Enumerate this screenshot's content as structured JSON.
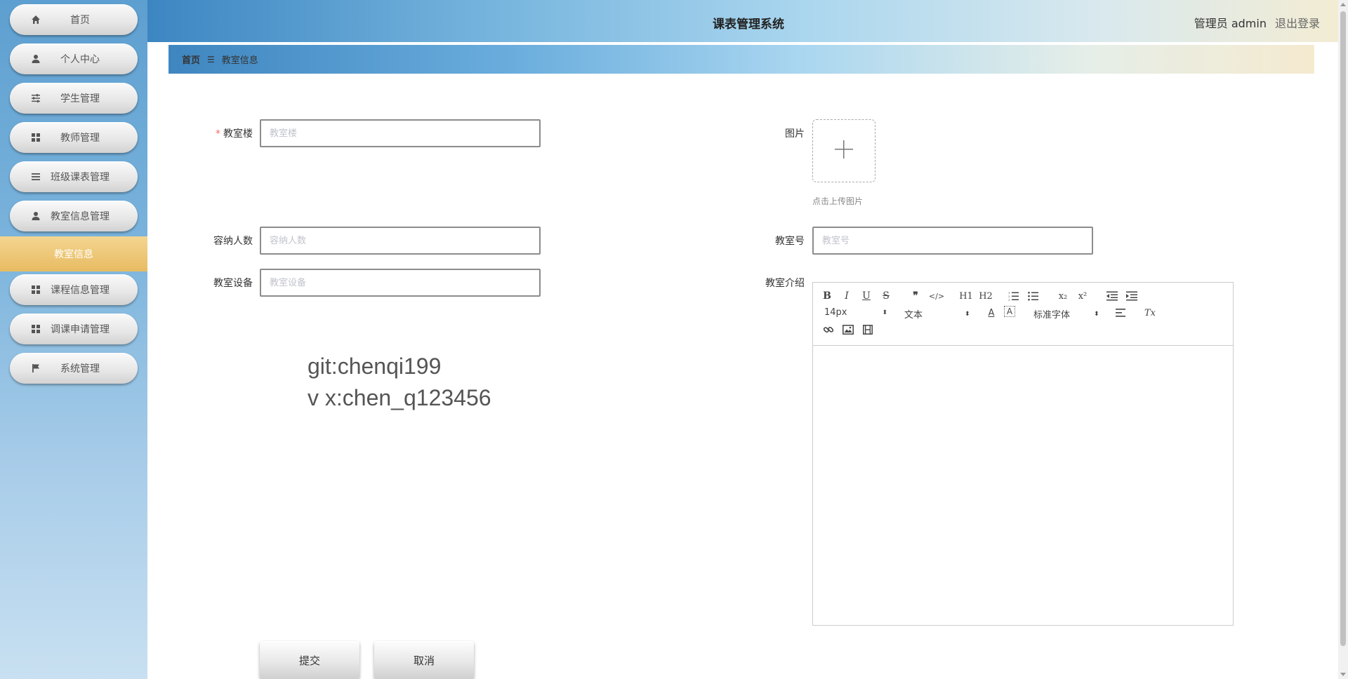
{
  "app": {
    "title": "课表管理系统"
  },
  "header": {
    "user_label": "管理员 admin",
    "logout_label": "退出登录"
  },
  "sidebar": {
    "items": [
      {
        "label": "首页",
        "icon": "home-icon"
      },
      {
        "label": "个人中心",
        "icon": "user-icon"
      },
      {
        "label": "学生管理",
        "icon": "sliders-icon"
      },
      {
        "label": "教师管理",
        "icon": "grid-icon"
      },
      {
        "label": "班级课表管理",
        "icon": "list-icon"
      },
      {
        "label": "教室信息管理",
        "icon": "user-icon"
      },
      {
        "label": "课程信息管理",
        "icon": "grid-icon"
      },
      {
        "label": "调课申请管理",
        "icon": "grid-icon"
      },
      {
        "label": "系统管理",
        "icon": "flag-icon"
      }
    ],
    "active_submenu": "教室信息"
  },
  "breadcrumb": {
    "home": "首页",
    "separator": "☰",
    "current": "教室信息"
  },
  "form": {
    "building": {
      "label": "教室楼",
      "placeholder": "教室楼",
      "required": true
    },
    "image": {
      "label": "图片",
      "tip": "点击上传图片"
    },
    "capacity": {
      "label": "容纳人数",
      "placeholder": "容纳人数"
    },
    "room_no": {
      "label": "教室号",
      "placeholder": "教室号"
    },
    "equipment": {
      "label": "教室设备",
      "placeholder": "教室设备"
    },
    "intro": {
      "label": "教室介绍"
    }
  },
  "editor": {
    "font_size": "14px",
    "block_type": "文本",
    "font_family": "标准字体",
    "buttons": {
      "bold": "B",
      "italic": "I",
      "underline": "U",
      "strike": "S",
      "quote": "❞",
      "code": "</>",
      "h1": "H1",
      "h2": "H2",
      "sub": "x₂",
      "sup": "x²",
      "text_color": "A",
      "bg_color": "A",
      "clean": "Tx"
    }
  },
  "watermark": {
    "line1": "git:chenqi199",
    "line2": "v x:chen_q123456"
  },
  "actions": {
    "submit": "提交",
    "cancel": "取消"
  }
}
